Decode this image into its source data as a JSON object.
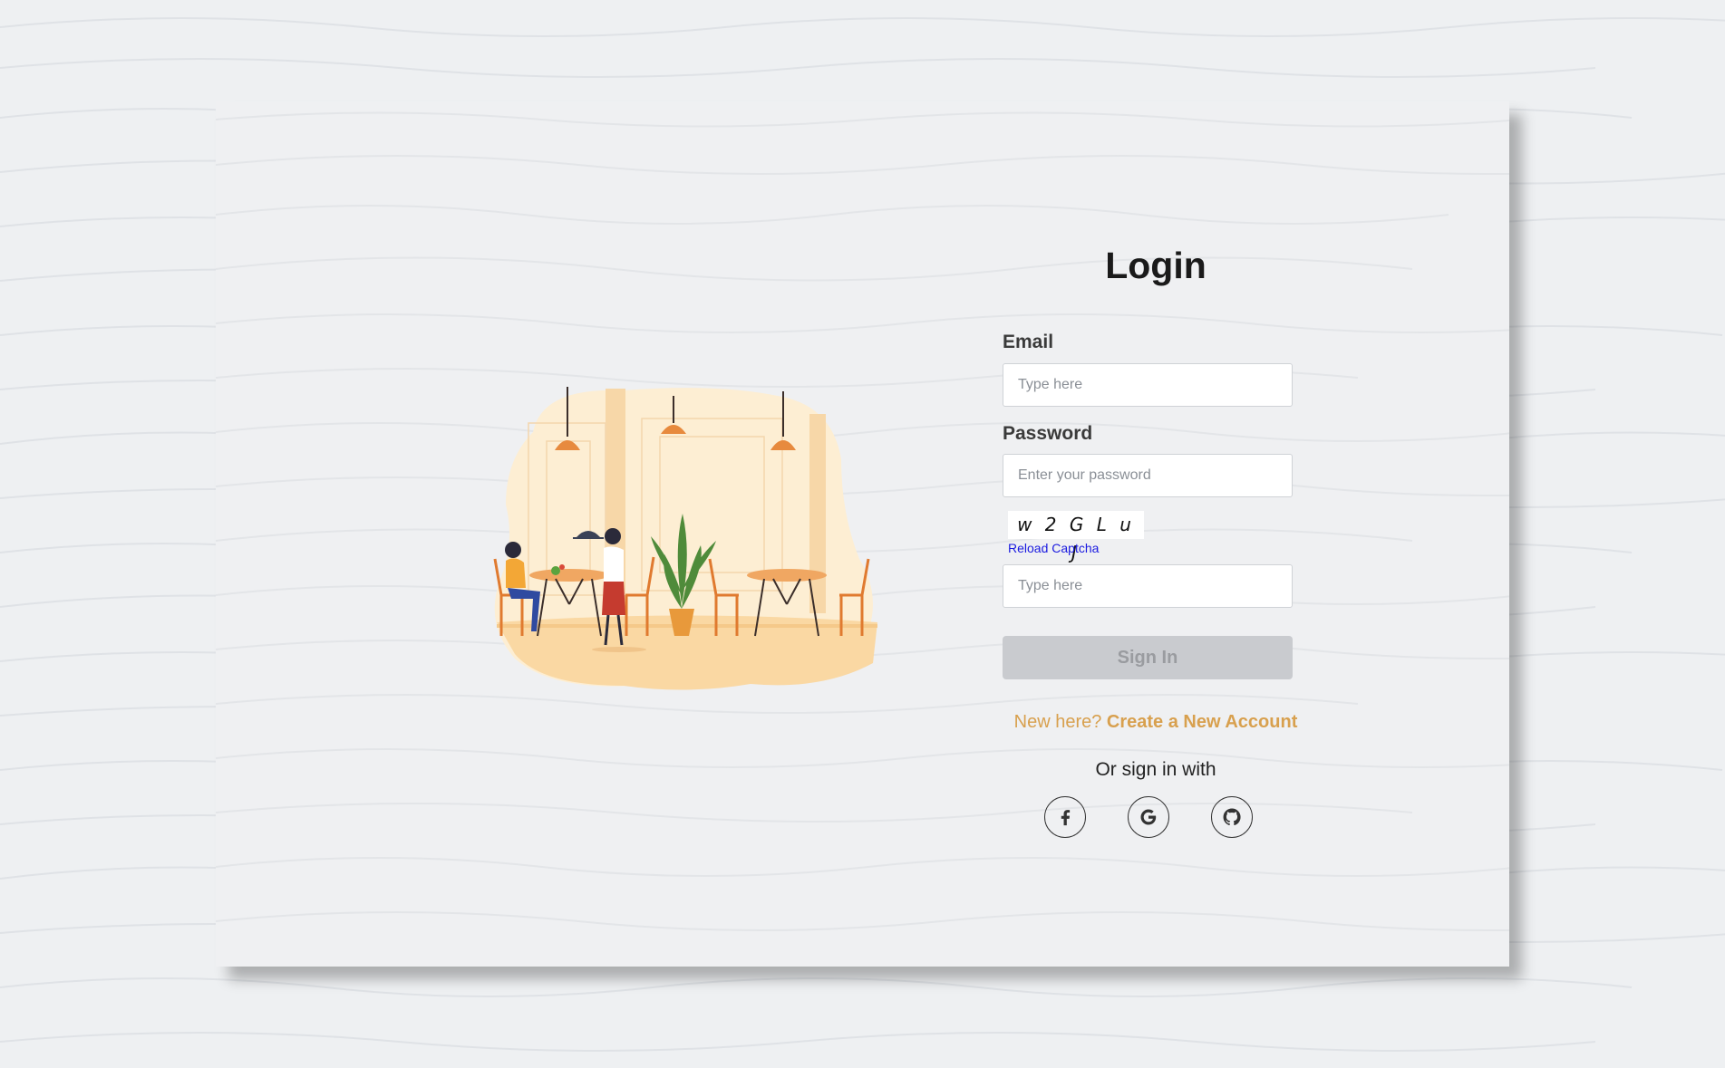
{
  "login": {
    "title": "Login",
    "email_label": "Email",
    "email_placeholder": "Type here",
    "password_label": "Password",
    "password_placeholder": "Enter your password",
    "captcha_text": "w 2 G L u J",
    "reload_captcha": "Reload Captcha",
    "captcha_placeholder": "Type here",
    "signin_label": "Sign In",
    "new_here_text": "New here?",
    "create_account": "Create a New Account",
    "or_sign_in": "Or sign in with"
  },
  "social_buttons": [
    {
      "icon": "facebook-icon"
    },
    {
      "icon": "google-icon"
    },
    {
      "icon": "github-icon"
    }
  ],
  "colors": {
    "accent": "#d8a04e",
    "button_disabled": "#c9cbcf",
    "link_blue": "#1a1ae0",
    "background": "#eef0f2"
  }
}
